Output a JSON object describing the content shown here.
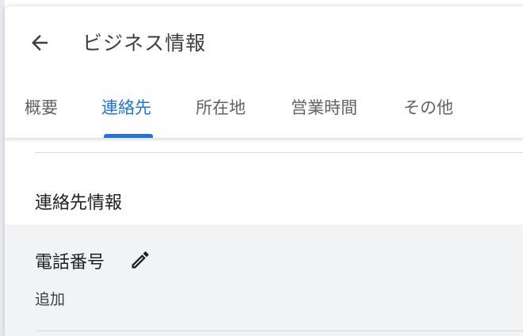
{
  "header": {
    "title": "ビジネス情報",
    "back_icon": "arrow-left-icon"
  },
  "tabs": [
    {
      "label": "概要",
      "active": false
    },
    {
      "label": "連絡先",
      "active": true
    },
    {
      "label": "所在地",
      "active": false
    },
    {
      "label": "営業時間",
      "active": false
    },
    {
      "label": "その他",
      "active": false
    }
  ],
  "content": {
    "section_heading": "連絡先情報",
    "phone": {
      "label": "電話番号",
      "edit_icon": "pencil-icon",
      "action": "追加"
    }
  },
  "colors": {
    "accent": "#1a73e8",
    "text_primary": "#202124",
    "text_secondary": "#5f6368",
    "row_highlight": "#f1f3f4",
    "divider": "#dadce0"
  }
}
